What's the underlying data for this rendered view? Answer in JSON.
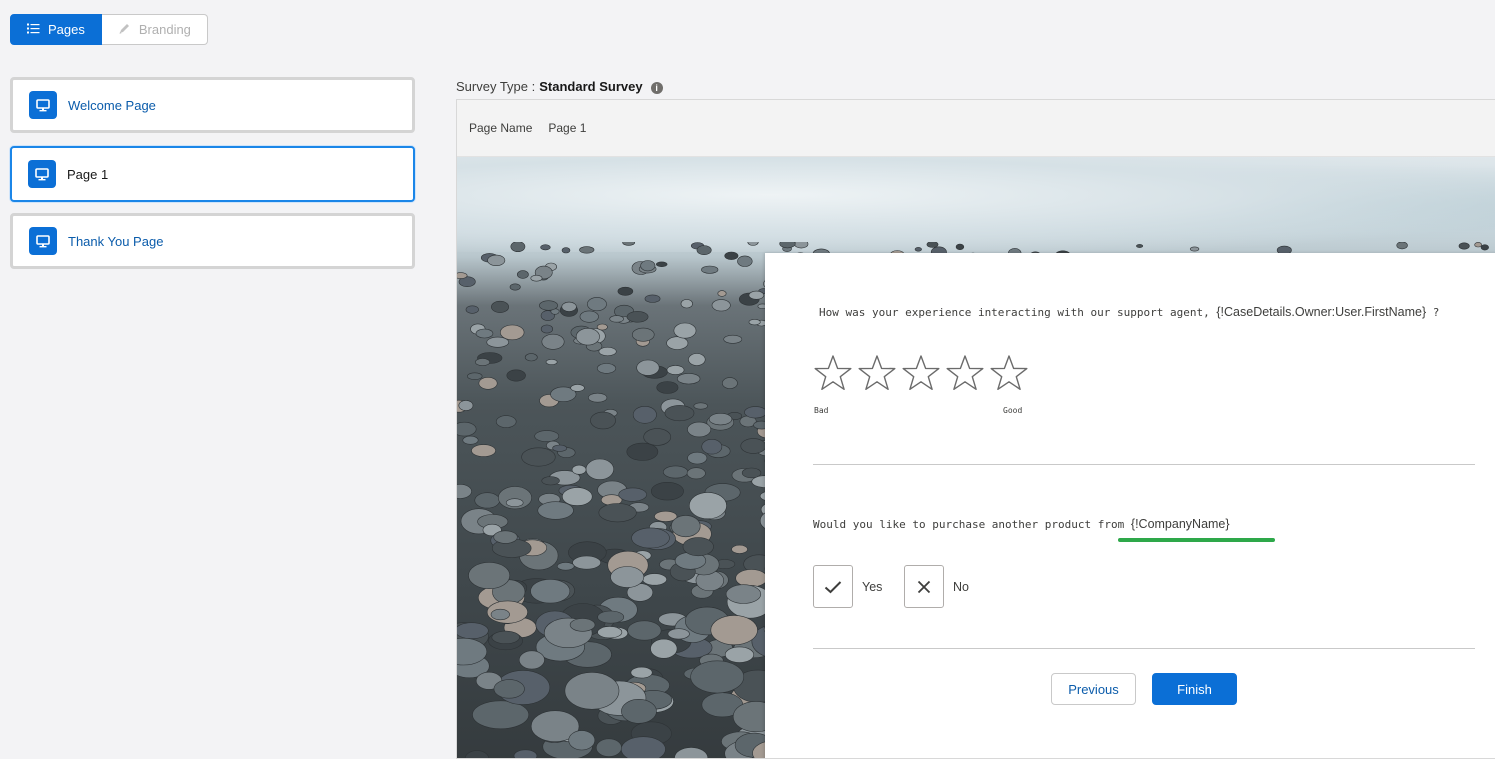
{
  "toggle": {
    "pages_label": "Pages",
    "branding_label": "Branding",
    "pages_icon": "list-icon",
    "branding_icon": "pencil-icon"
  },
  "pages": [
    {
      "label": "Welcome Page",
      "icon": "monitor-icon",
      "selected": false
    },
    {
      "label": "Page 1",
      "icon": "monitor-icon",
      "selected": true
    },
    {
      "label": "Thank You Page",
      "icon": "monitor-icon",
      "selected": false
    }
  ],
  "survey_type": {
    "label": "Survey Type :",
    "value": "Standard Survey"
  },
  "page_name": {
    "label": "Page Name",
    "value": "Page 1"
  },
  "question1": {
    "text": "How was your experience interacting with our support agent,",
    "merge_field": "{!CaseDetails.Owner:User.FirstName}",
    "suffix": "?",
    "rating_count": 5,
    "low_label": "Bad",
    "high_label": "Good"
  },
  "question2": {
    "text": "Would you like to purchase another product from",
    "merge_field": "{!CompanyName}",
    "yes_label": "Yes",
    "no_label": "No"
  },
  "buttons": {
    "previous": "Previous",
    "finish": "Finish"
  },
  "colors": {
    "brand": "#0b6fd6",
    "highlight_underline": "#2ea84a"
  }
}
